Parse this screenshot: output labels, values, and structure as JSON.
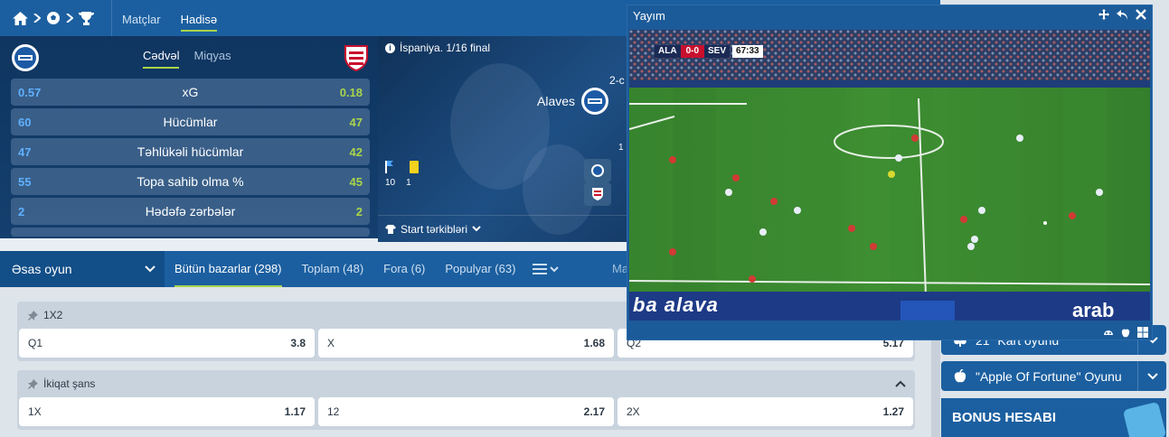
{
  "header": {
    "tabs": [
      {
        "label": "Matçlar"
      },
      {
        "label": "Hadisə"
      }
    ]
  },
  "stats": {
    "tabs": [
      {
        "label": "Cədvəl"
      },
      {
        "label": "Miqyas"
      }
    ],
    "rows": [
      {
        "home": "0.57",
        "label": "xG",
        "away": "0.18"
      },
      {
        "home": "60",
        "label": "Hücümlar",
        "away": "47"
      },
      {
        "home": "47",
        "label": "Təhlükəli hücümlar",
        "away": "42"
      },
      {
        "home": "55",
        "label": "Topa sahib olma %",
        "away": "45"
      },
      {
        "home": "2",
        "label": "Hədəfə zərbələr",
        "away": "2"
      }
    ]
  },
  "match": {
    "league": "İspaniya. 1/16 final",
    "home_team": "Alaves",
    "period": "2-c",
    "corners": "10",
    "yellow_cards": "1",
    "row_marker": "1",
    "lineups_label": "Start tərkibləri"
  },
  "markets": {
    "main_label": "Əsas oyun",
    "tabs": [
      {
        "label": "Bütün bazarlar (298)"
      },
      {
        "label": "Toplam (48)"
      },
      {
        "label": "Fora (6)"
      },
      {
        "label": "Populyar (63)"
      }
    ],
    "truncated": "Ma"
  },
  "groups": [
    {
      "title": "1X2",
      "cells": [
        {
          "name": "Q1",
          "odd": "3.8"
        },
        {
          "name": "X",
          "odd": "1.68"
        },
        {
          "name": "Q2",
          "odd": "5.17"
        }
      ]
    },
    {
      "title": "İkiqat şans",
      "cells": [
        {
          "name": "1X",
          "odd": "1.17"
        },
        {
          "name": "12",
          "odd": "2.17"
        },
        {
          "name": "2X",
          "odd": "1.27"
        }
      ]
    }
  ],
  "sidebar": {
    "buttons": [
      {
        "label": "21\" Kart oyunu"
      },
      {
        "label": "\"Apple Of Fortune\" Oyunu"
      }
    ],
    "bonus_title": "BONUS HESABI"
  },
  "player": {
    "title": "Yayım",
    "home_abbr": "ALA",
    "away_abbr": "SEV",
    "score": "0-0",
    "clock": "67:33",
    "banner": "ba alava",
    "banner_right": "arab"
  },
  "colors": {
    "accent": "#a9d44a",
    "brand": "#1b5fa0",
    "home_stat": "#5fb0ff"
  }
}
